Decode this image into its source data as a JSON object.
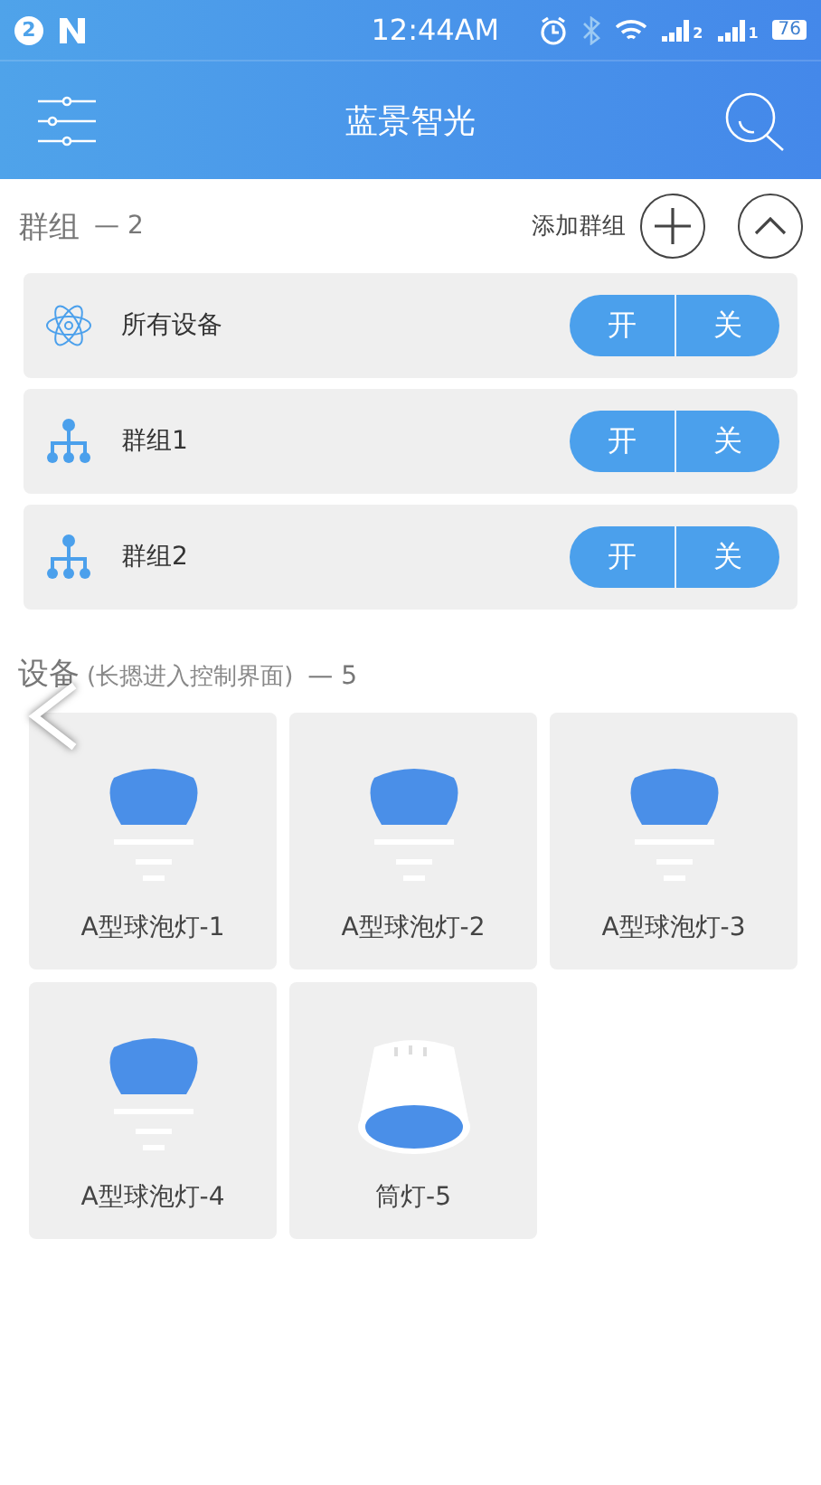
{
  "status_bar": {
    "notification_count": "2",
    "time": "12:44AM",
    "signal_1": "2",
    "signal_2": "1",
    "battery": "76"
  },
  "app_bar": {
    "title": "蓝景智光"
  },
  "groups_section": {
    "title": "群组",
    "count": "— 2",
    "add_label": "添加群组",
    "items": [
      {
        "kind": "all",
        "name": "所有设备",
        "on_label": "开",
        "off_label": "关"
      },
      {
        "kind": "group",
        "name": "群组1",
        "on_label": "开",
        "off_label": "关"
      },
      {
        "kind": "group",
        "name": "群组2",
        "on_label": "开",
        "off_label": "关"
      }
    ]
  },
  "devices_section": {
    "title": "设备",
    "hint": "(长摁进入控制界面)",
    "count": "— 5",
    "items": [
      {
        "kind": "bulb",
        "name": "A型球泡灯-1"
      },
      {
        "kind": "bulb",
        "name": "A型球泡灯-2"
      },
      {
        "kind": "bulb",
        "name": "A型球泡灯-3"
      },
      {
        "kind": "bulb",
        "name": "A型球泡灯-4"
      },
      {
        "kind": "downlight",
        "name": "筒灯-5"
      }
    ]
  }
}
